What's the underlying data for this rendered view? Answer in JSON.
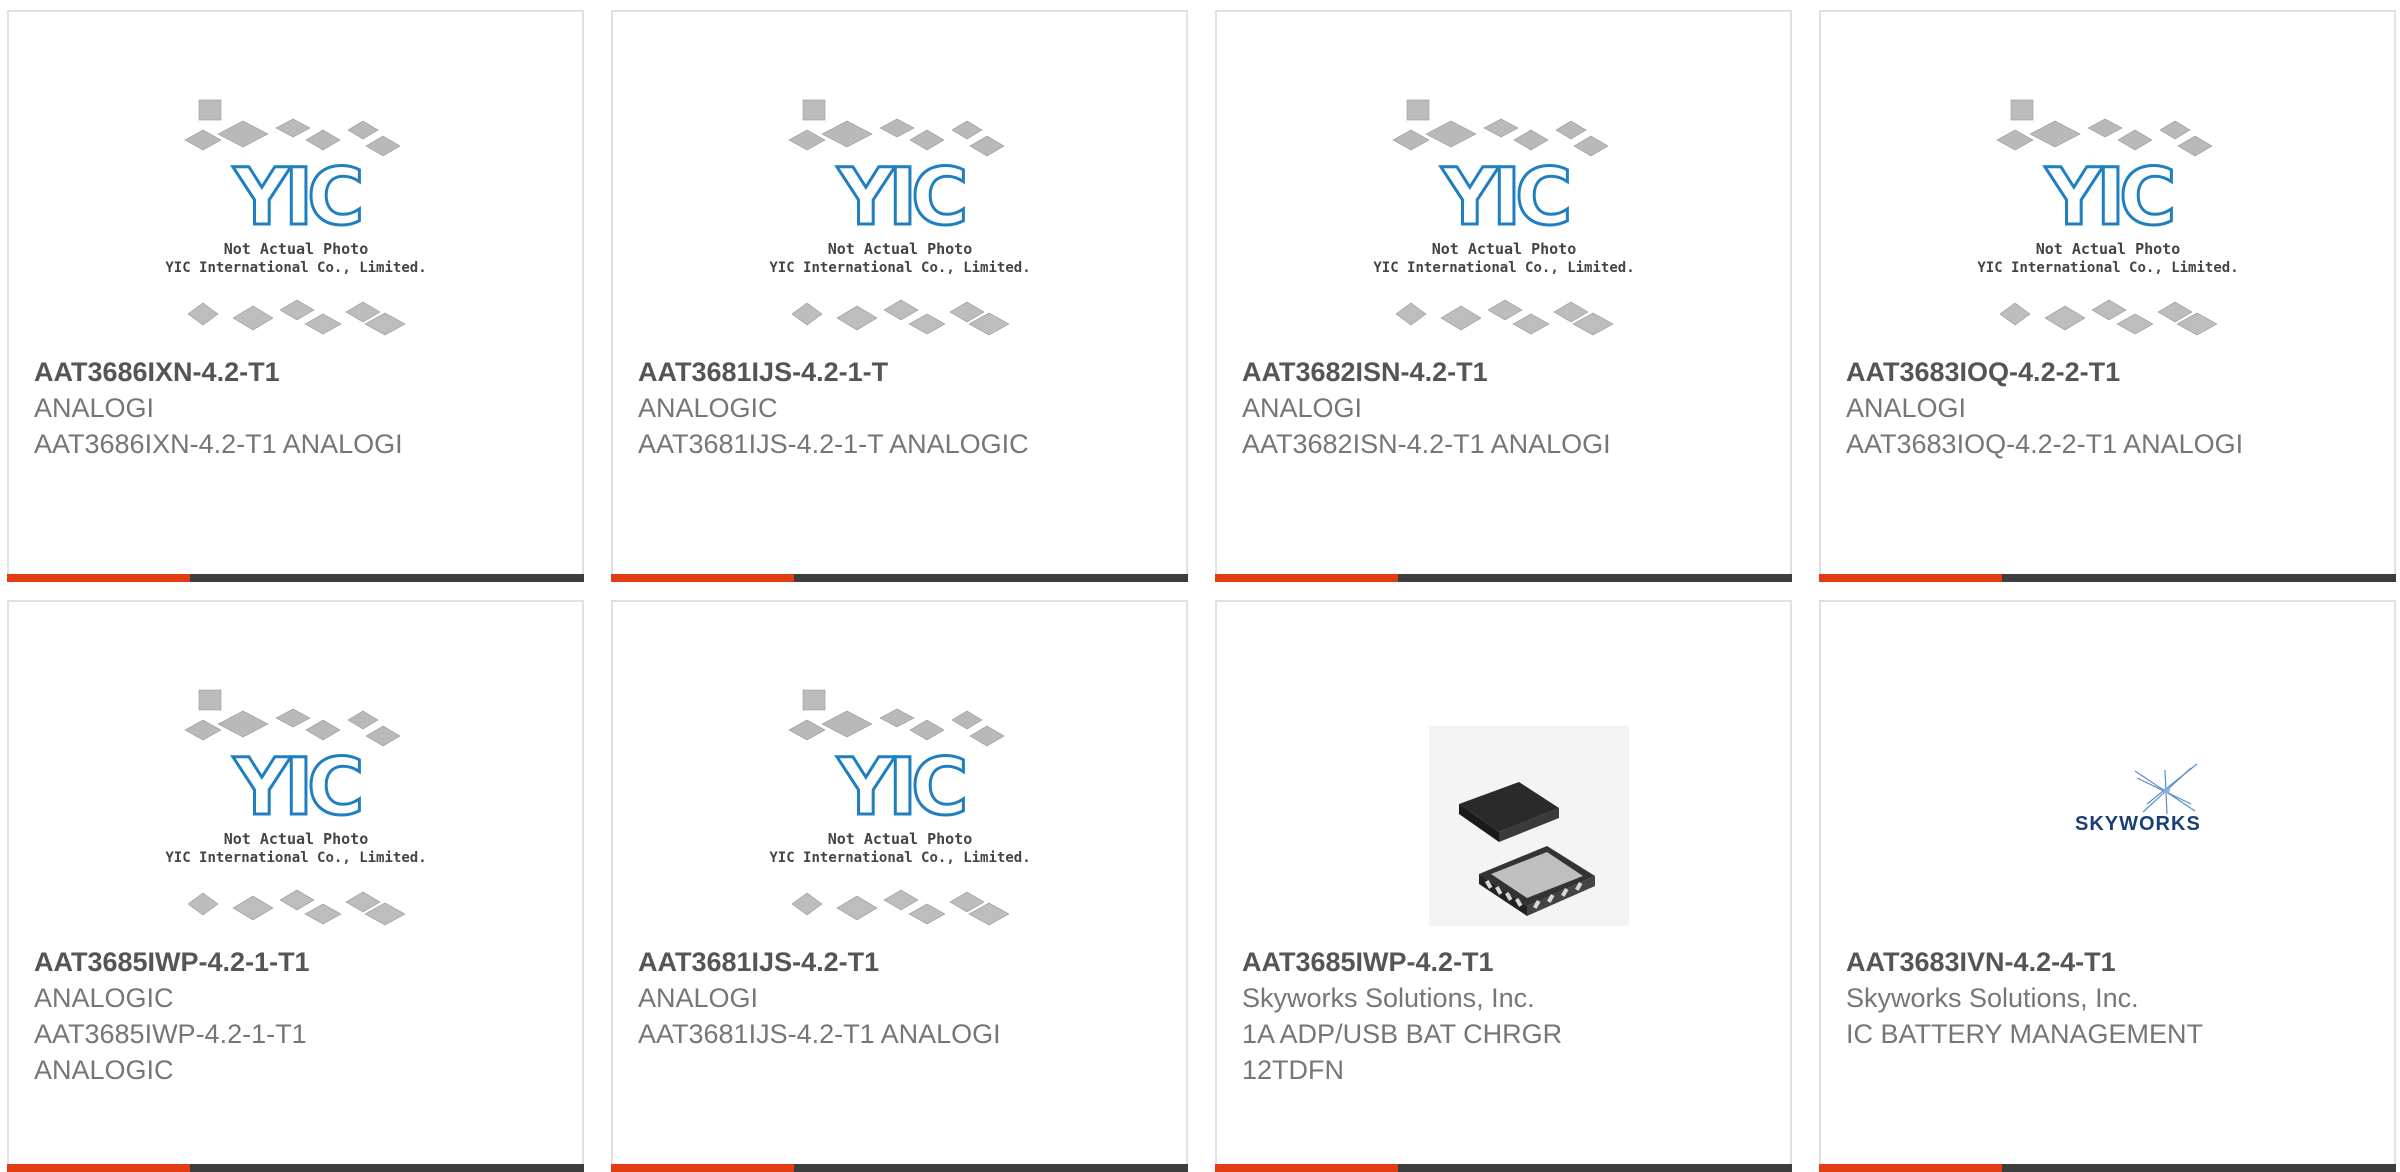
{
  "products": [
    {
      "part_number": "AAT3686IXN-4.2-T1",
      "manufacturer": "ANALOGI",
      "description": "AAT3686IXN-4.2-T1 ANALOGI",
      "image": "yic-placeholder"
    },
    {
      "part_number": "AAT3681IJS-4.2-1-T",
      "manufacturer": "ANALOGIC",
      "description": "AAT3681IJS-4.2-1-T ANALOGIC",
      "image": "yic-placeholder"
    },
    {
      "part_number": "AAT3682ISN-4.2-T1",
      "manufacturer": "ANALOGI",
      "description": "AAT3682ISN-4.2-T1 ANALOGI",
      "image": "yic-placeholder"
    },
    {
      "part_number": "AAT3683IOQ-4.2-2-T1",
      "manufacturer": "ANALOGI",
      "description": "AAT3683IOQ-4.2-2-T1 ANALOGI",
      "image": "yic-placeholder"
    },
    {
      "part_number": "AAT3685IWP-4.2-1-T1",
      "manufacturer": "ANALOGIC",
      "description": "AAT3685IWP-4.2-1-T1",
      "description_line2": "ANALOGIC",
      "image": "yic-placeholder"
    },
    {
      "part_number": "AAT3681IJS-4.2-T1",
      "manufacturer": "ANALOGI",
      "description": "AAT3681IJS-4.2-T1 ANALOGI",
      "image": "yic-placeholder"
    },
    {
      "part_number": "AAT3685IWP-4.2-T1",
      "manufacturer": "Skyworks Solutions, Inc.",
      "description": "1A ADP/USB BAT CHRGR",
      "description_line2": "12TDFN",
      "image": "chip-photo"
    },
    {
      "part_number": "AAT3683IVN-4.2-4-T1",
      "manufacturer": "Skyworks Solutions, Inc.",
      "description": "IC BATTERY MANAGEMENT",
      "image": "skyworks-logo"
    }
  ],
  "placeholder": {
    "line1": "Not Actual Photo",
    "line2": "YIC International Co., Limited.",
    "logo": "YIC"
  },
  "skyworks_logo_text": "SKYWORKS",
  "colors": {
    "accent": "#e23c12",
    "bar": "#3d3d3d",
    "yic_blue": "#1f7fc0",
    "skyworks_blue": "#1b3f74"
  }
}
